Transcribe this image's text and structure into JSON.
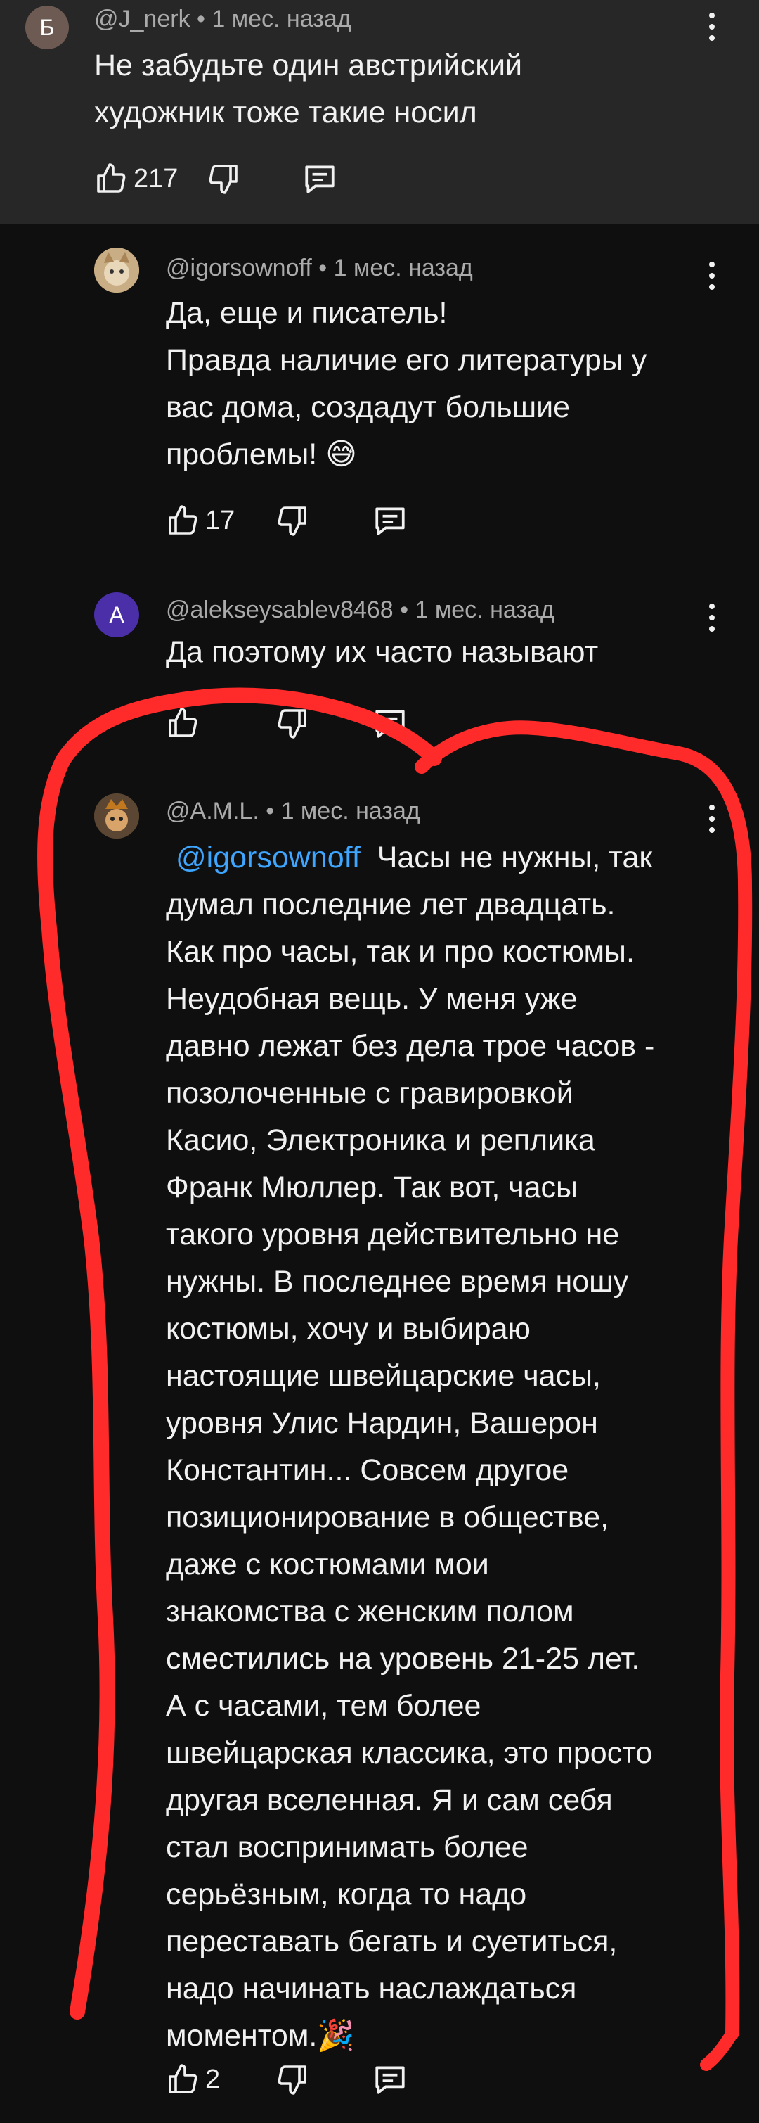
{
  "comments": [
    {
      "avatar_letter": "Б",
      "author": "@J_nerk",
      "time": "1 мес. назад",
      "lines": [
        "Не забудьте один австрийский",
        "художник тоже такие носил"
      ],
      "likes": "217"
    },
    {
      "avatar_letter": "",
      "author": "@igorsownoff",
      "time": "1 мес. назад",
      "lines": [
        "Да, еще и писатель!",
        "Правда наличие его литературы у",
        "вас дома, создадут большие",
        "проблемы! 😅"
      ],
      "likes": "17"
    },
    {
      "avatar_letter": "A",
      "author": "@alekseysablev8468",
      "time": "1 мес. назад",
      "lines": [
        "Да поэтому их часто называют"
      ],
      "likes": ""
    },
    {
      "avatar_letter": "",
      "author": "@A.M.L.",
      "time": "1 мес. назад",
      "mention": "@igorsownoff",
      "first_line_rest": "Часы не нужны, так",
      "lines": [
        "думал последние лет двадцать.",
        "Как про часы, так и про костюмы.",
        "Неудобная вещь. У меня уже",
        "давно лежат без дела трое часов -",
        "позолоченные с гравировкой",
        "Касио, Электроника и реплика",
        "Франк Мюллер. Так вот, часы",
        "такого уровня действительно не",
        "нужны. В последнее время ношу",
        "костюмы, хочу и выбираю",
        "настоящие швейцарские часы,",
        "уровня Улис Нардин, Вашерон",
        "Константин... Совсем другое",
        "позиционирование  в обществе,",
        "даже с костюмами мои",
        "знакомства с женским полом",
        "сместились на уровень 21-25 лет.",
        "А с часами, тем более",
        "швейцарская классика, это просто",
        "другая вселенная. Я и сам себя",
        "стал воспринимать более",
        "серьёзным, когда то надо",
        "переставать бегать и суетиться,",
        "надо начинать наслаждаться",
        "моментом.🎉"
      ],
      "likes": "2"
    }
  ],
  "meta_separator": "•",
  "icons": [
    "like-icon",
    "dislike-icon",
    "reply-icon",
    "more-options-icon"
  ],
  "colors": {
    "background": "#0f0f0f",
    "highlight": "#272727",
    "mention": "#3ea6ff",
    "scribble": "#ff2a2a",
    "avatar_a": "#4a2fa8",
    "avatar_b": "#6d5a52"
  }
}
